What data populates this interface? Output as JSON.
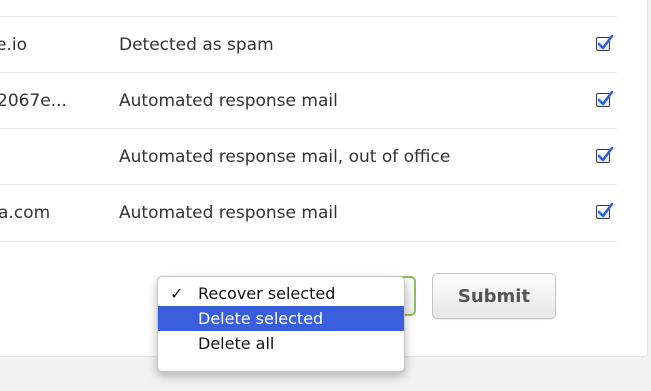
{
  "rows": [
    {
      "sender": "e.io",
      "reason": "Detected as spam",
      "checked": true
    },
    {
      "sender": "2067e...",
      "reason": "Automated response mail",
      "checked": true
    },
    {
      "sender": "",
      "reason": "Automated response mail, out of office",
      "checked": true
    },
    {
      "sender": "a.com",
      "reason": "Automated response mail",
      "checked": true
    }
  ],
  "action_menu": {
    "check_mark": "✓",
    "items": [
      {
        "label": "Recover selected",
        "checked": true
      },
      {
        "label": "Delete selected",
        "highlighted": true
      },
      {
        "label": "Delete all"
      }
    ]
  },
  "submit_label": "Submit",
  "colors": {
    "highlight": "#3a5fdc",
    "select_focus_border": "#8fbf5a"
  }
}
